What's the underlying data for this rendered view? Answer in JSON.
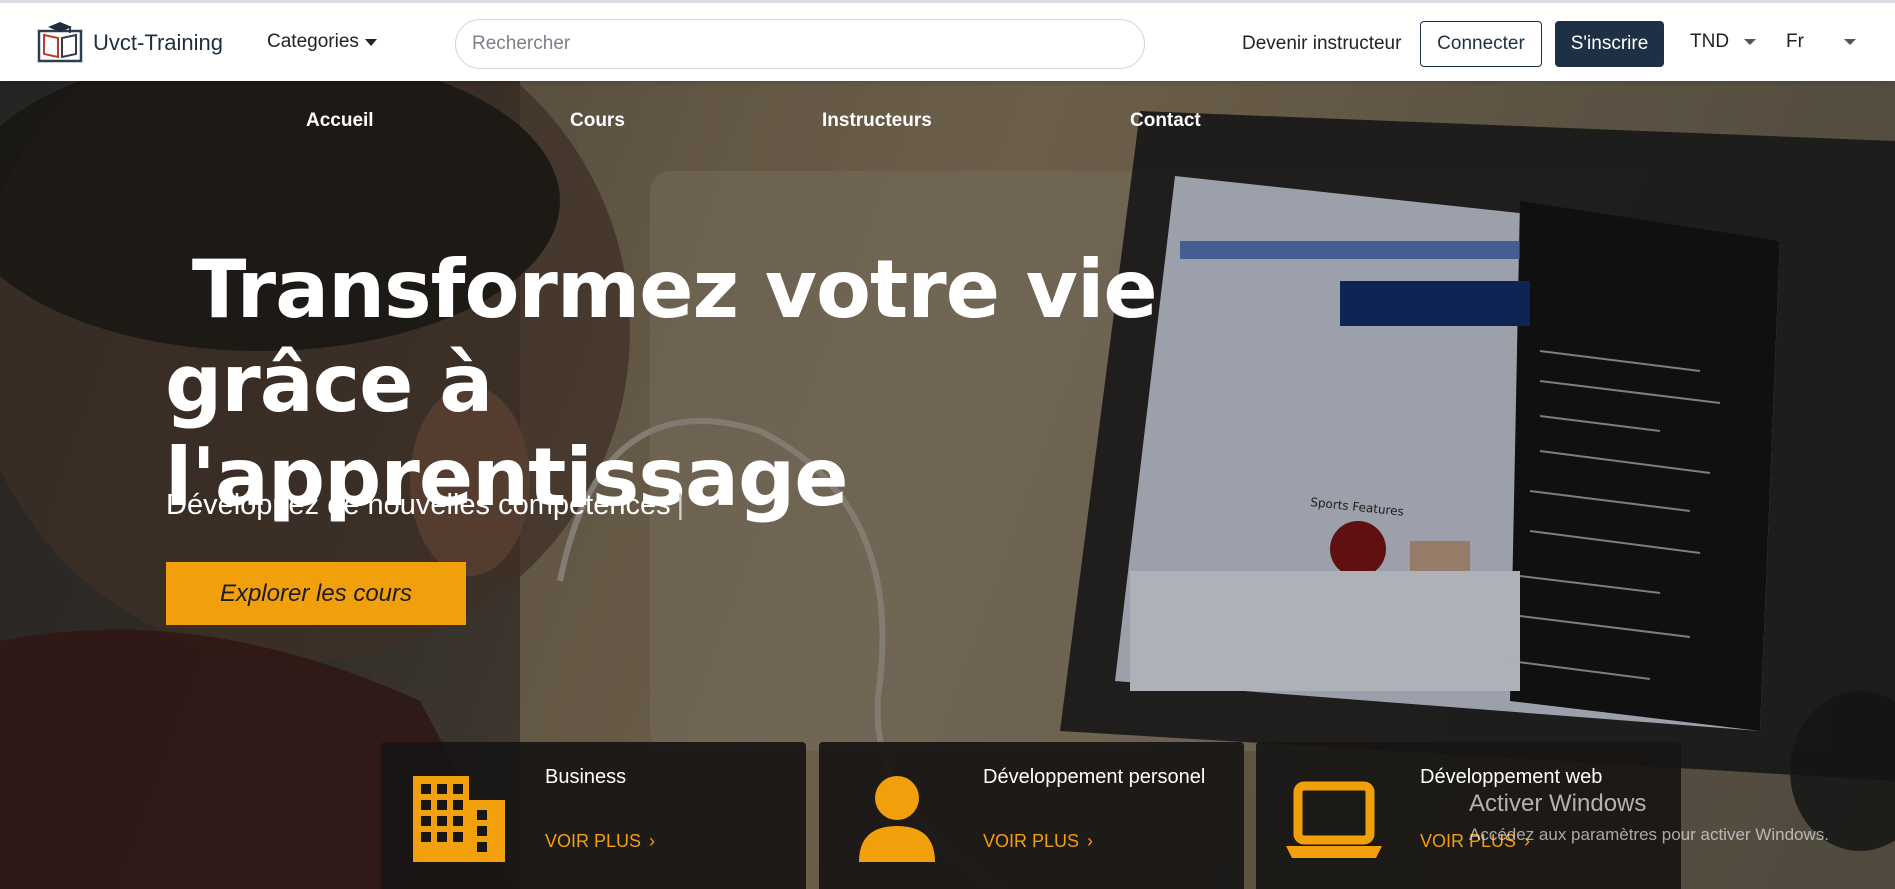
{
  "header": {
    "brand": "Uvct-Training",
    "categories_label": "Categories",
    "search_placeholder": "Rechercher",
    "become_instructor": "Devenir instructeur",
    "login_label": "Connecter",
    "signup_label": "S'inscrire",
    "currency": "TND",
    "language": "Fr"
  },
  "hero_nav": {
    "items": [
      {
        "label": "Accueil"
      },
      {
        "label": "Cours"
      },
      {
        "label": "Instructeurs"
      },
      {
        "label": "Contact"
      }
    ]
  },
  "hero": {
    "headline_line1": " Transformez votre vie",
    "headline_line2": "grâce à l'apprentissage",
    "subline": "Développez de nouvelles compétences",
    "cursor": "|",
    "cta_label": "Explorer les cours"
  },
  "cards": [
    {
      "title": "Business",
      "link": "VOIR PLUS",
      "icon": "building-icon"
    },
    {
      "title": "Développement personel",
      "link": "VOIR PLUS",
      "icon": "person-icon"
    },
    {
      "title": "Développement web",
      "link": "VOIR PLUS",
      "icon": "laptop-icon"
    }
  ],
  "watermark": {
    "title": "Activer Windows",
    "subtitle": "Accédez aux paramètres pour activer Windows."
  },
  "colors": {
    "brand_dark": "#1e3045",
    "accent": "#f29f0c"
  }
}
